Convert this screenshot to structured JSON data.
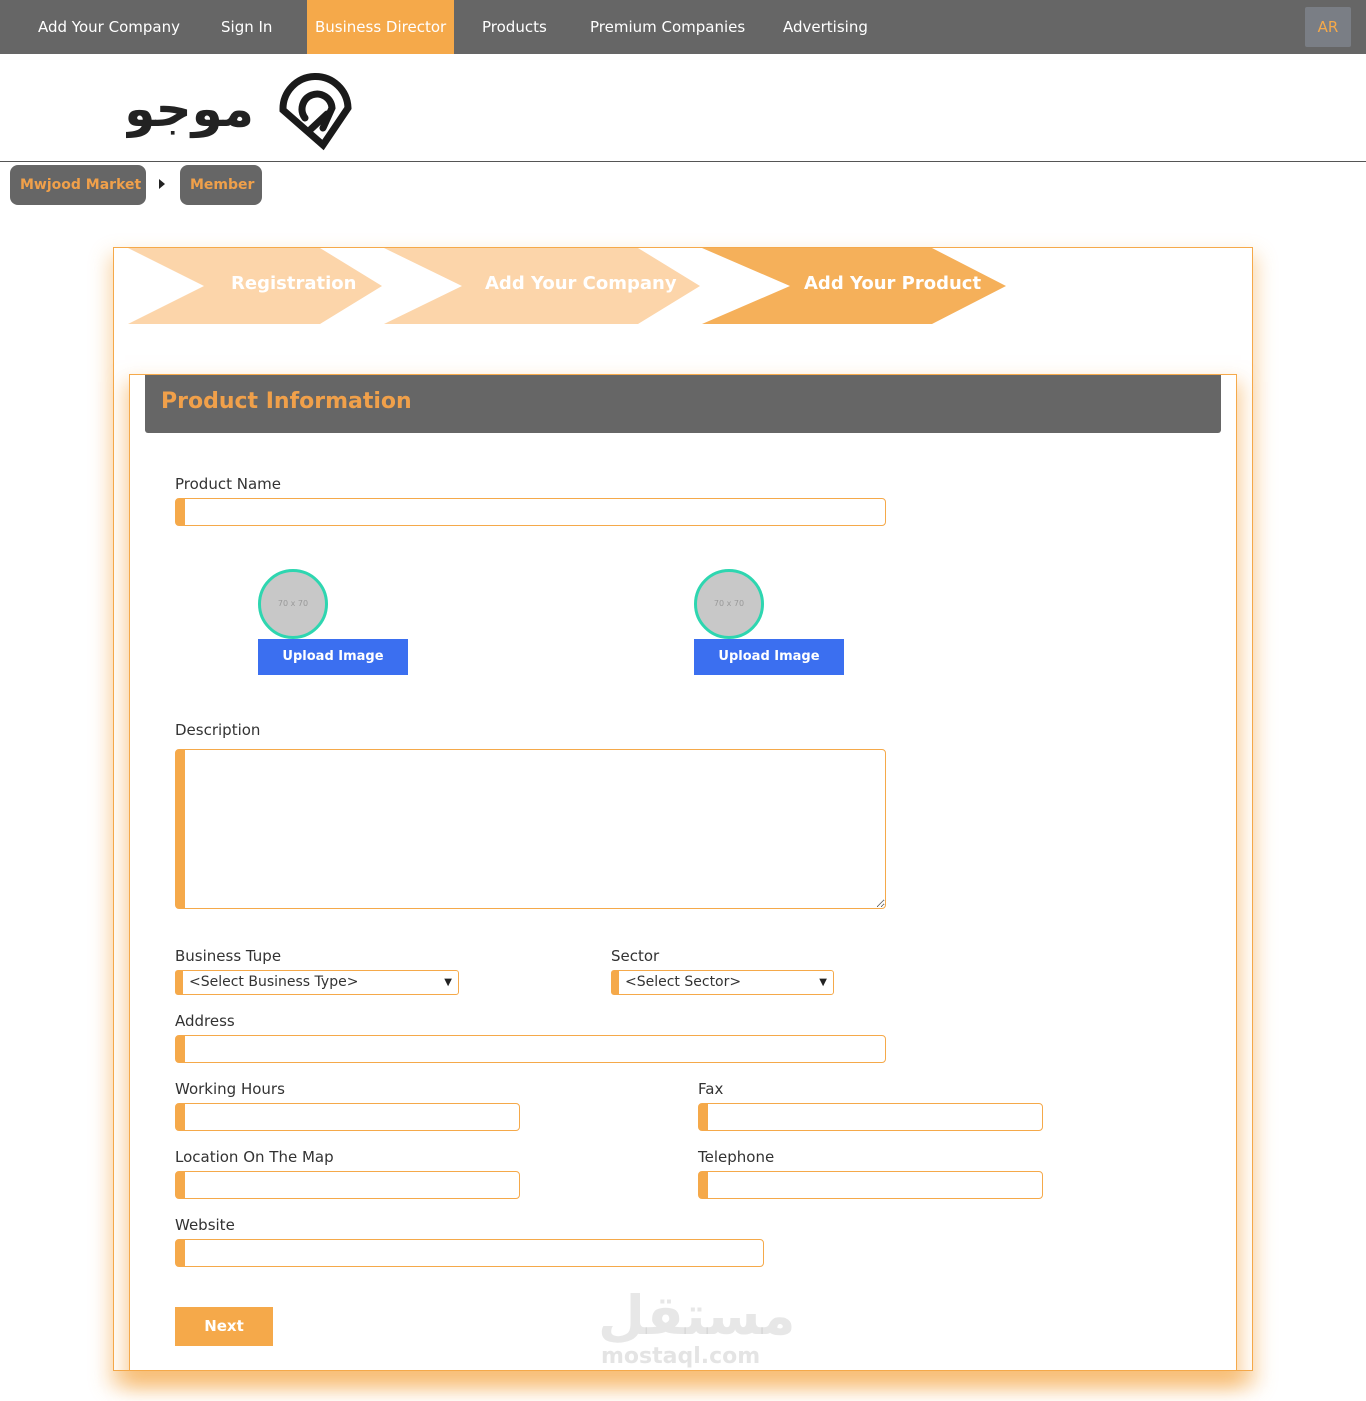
{
  "nav": {
    "items": [
      {
        "label": "Add Your Company"
      },
      {
        "label": "Sign In"
      },
      {
        "label": "Business Director"
      },
      {
        "label": "Products"
      },
      {
        "label": "Premium Companies"
      },
      {
        "label": "Advertising"
      }
    ],
    "active_index": 2,
    "lang_toggle": "AR"
  },
  "logo": {
    "text": "موجود"
  },
  "breadcrumb": {
    "items": [
      {
        "label": "Mwjood Market"
      },
      {
        "label": "Member"
      }
    ]
  },
  "steps": [
    {
      "label": "Registration",
      "state": "done"
    },
    {
      "label": "Add Your Company",
      "state": "done"
    },
    {
      "label": "Add Your Product",
      "state": "active"
    }
  ],
  "panel": {
    "title": "Product Information"
  },
  "form": {
    "product_name": {
      "label": "Product Name",
      "value": ""
    },
    "images": [
      {
        "placeholder": "70 x 70",
        "button": "Upload Image"
      },
      {
        "placeholder": "70 x 70",
        "button": "Upload Image"
      }
    ],
    "description": {
      "label": "Description",
      "value": ""
    },
    "business_type": {
      "label": "Business Tupe",
      "selected": "<Select Business Type>"
    },
    "sector": {
      "label": "Sector",
      "selected": "<Select Sector>"
    },
    "address": {
      "label": "Address",
      "value": ""
    },
    "working_hours": {
      "label": "Working Hours",
      "value": ""
    },
    "fax": {
      "label": "Fax",
      "value": ""
    },
    "location": {
      "label": "Location On The Map",
      "value": ""
    },
    "telephone": {
      "label": "Telephone",
      "value": ""
    },
    "website": {
      "label": "Website",
      "value": ""
    },
    "next": "Next"
  },
  "watermark": {
    "arabic": "مستقل",
    "latin": "mostaql.com"
  },
  "colors": {
    "accent": "#f5a94a",
    "accent_light": "#fcd5aa",
    "nav_bg": "#666666",
    "upload_blue": "#3b6ff0",
    "avatar_ring": "#2ed6b0"
  }
}
